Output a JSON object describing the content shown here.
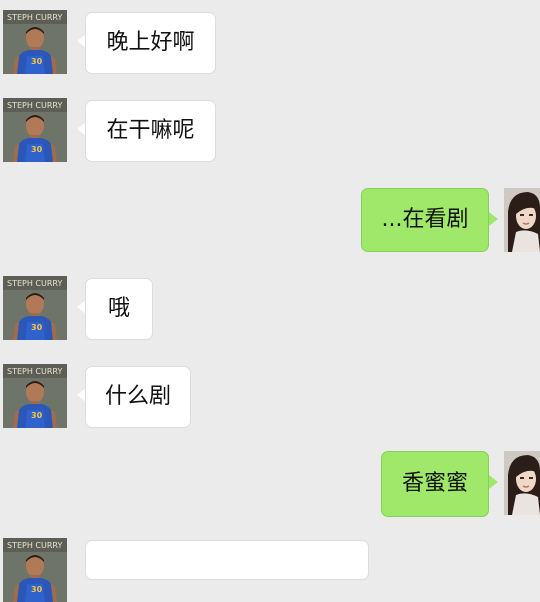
{
  "chat": {
    "messages": [
      {
        "side": "left",
        "avatar": "curry-avatar",
        "text": "晚上好啊"
      },
      {
        "side": "left",
        "avatar": "curry-avatar",
        "text": "在干嘛呢"
      },
      {
        "side": "right",
        "avatar": "girl-avatar",
        "text": "...在看剧"
      },
      {
        "side": "left",
        "avatar": "curry-avatar",
        "text": "哦"
      },
      {
        "side": "left",
        "avatar": "curry-avatar",
        "text": "什么剧"
      },
      {
        "side": "right",
        "avatar": "girl-avatar",
        "text": "香蜜蜜"
      },
      {
        "side": "left",
        "avatar": "curry-avatar",
        "text": ""
      }
    ]
  },
  "colors": {
    "background": "#ebebeb",
    "bubble_left": "#ffffff",
    "bubble_right": "#9fe86a"
  }
}
